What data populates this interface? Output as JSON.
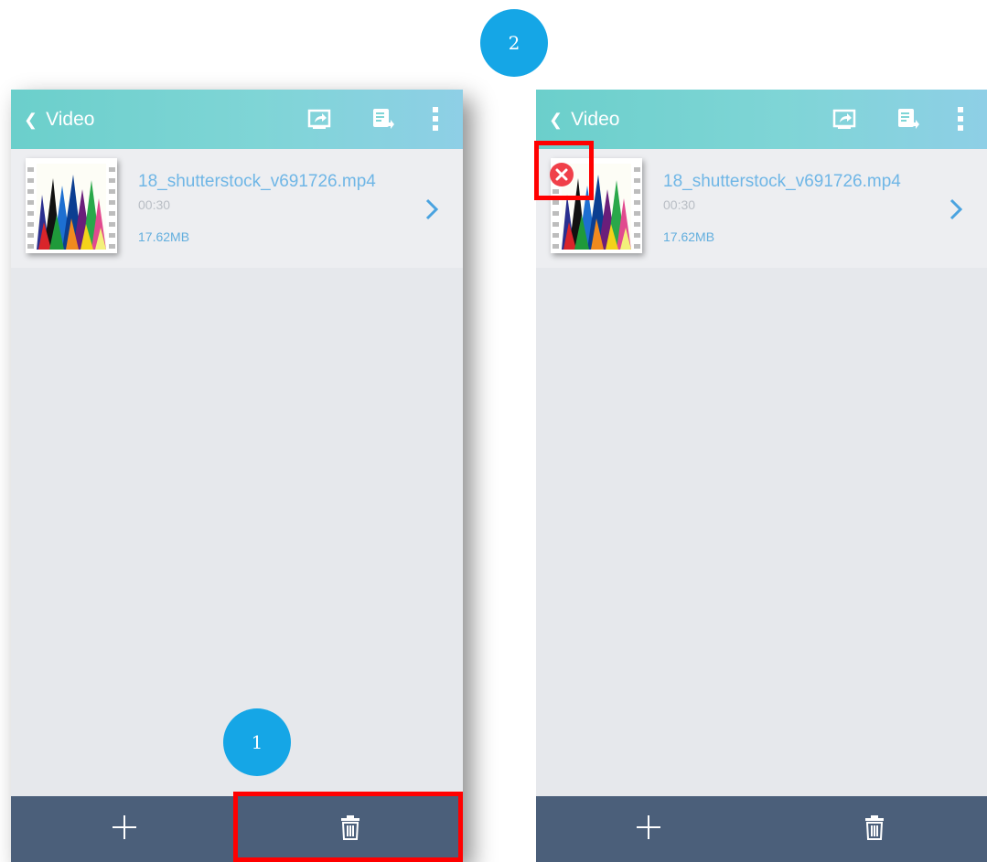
{
  "steps": {
    "first": "1",
    "second": "2"
  },
  "screens": [
    {
      "topbar": {
        "back_icon": "chevron-left-icon",
        "title": "Video",
        "actions": [
          "screen-share-icon",
          "document-export-icon",
          "more-vertical-icon"
        ]
      },
      "file": {
        "name": "18_shutterstock_v691726.mp4",
        "duration": "00:30",
        "size": "17.62MB"
      },
      "bottombar": {
        "add_icon": "plus-icon",
        "delete_icon": "trash-icon"
      }
    },
    {
      "topbar": {
        "back_icon": "chevron-left-icon",
        "title": "Video",
        "actions": [
          "screen-share-icon",
          "document-export-icon",
          "more-vertical-icon"
        ]
      },
      "file": {
        "name": "18_shutterstock_v691726.mp4",
        "duration": "00:30",
        "size": "17.62MB",
        "delete_badge_icon": "remove-circle-icon"
      },
      "bottombar": {
        "add_icon": "plus-icon",
        "delete_icon": "trash-icon"
      }
    }
  ],
  "colors": {
    "step_badge": "#15a6e6",
    "highlight": "#ff0000",
    "header_gradient": [
      "#6bcfcb",
      "#8ecfe6"
    ],
    "bottom_bar": "#4b5f7a",
    "background": "#e6e8ec",
    "link_text": "#6fb6e6",
    "delete_badge": "#f0404a"
  }
}
